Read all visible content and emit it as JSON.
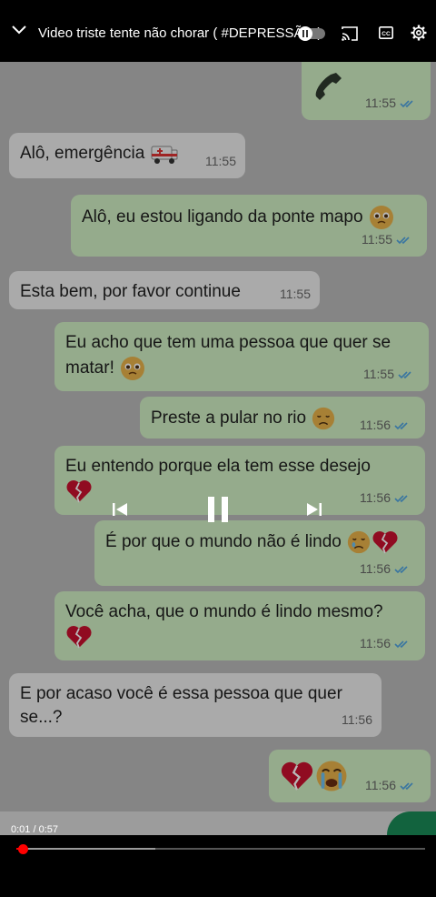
{
  "player": {
    "title": "Video triste tente não chorar ( #DEPRESSÃO )",
    "time_current": "0:01",
    "time_total": "0:57",
    "time_display": "0:01 / 0:57",
    "progress_fraction": 0.0175,
    "buffered_fraction": 0.34,
    "accent": "#ff0000"
  },
  "chat": {
    "messages": [
      {
        "dir": "out",
        "text": "",
        "time": "11:55",
        "emoji": "phone-icon"
      },
      {
        "dir": "in",
        "text": "Alô, emergência",
        "time": "11:55",
        "emoji": "ambulance-emoji"
      },
      {
        "dir": "out",
        "text": "Alô, eu estou ligando da ponte mapo",
        "time": "11:55",
        "emoji": "pleading-face-emoji"
      },
      {
        "dir": "in",
        "text": "Esta bem, por favor continue",
        "time": "11:55"
      },
      {
        "dir": "out",
        "text": "Eu acho que tem uma pessoa que quer se matar!",
        "time": "11:55",
        "emoji": "pleading-face-emoji"
      },
      {
        "dir": "out",
        "text": "Preste a pular no rio",
        "time": "11:56",
        "emoji": "disappointed-face-emoji"
      },
      {
        "dir": "out",
        "text": "Eu entendo porque ela tem esse desejo",
        "time": "11:56",
        "emoji": "broken-heart-emoji"
      },
      {
        "dir": "out",
        "text": "É por que o mundo não é lindo",
        "time": "11:56",
        "emoji": "sad-face-broken-heart-emoji"
      },
      {
        "dir": "out",
        "text": "Você acha, que o mundo é lindo mesmo?",
        "time": "11:56",
        "emoji": "broken-heart-emoji"
      },
      {
        "dir": "in",
        "text": "E por acaso você é essa pessoa que quer se...?",
        "time": "11:56"
      },
      {
        "dir": "out",
        "text": "",
        "time": "11:56",
        "emoji": "broken-heart-crying-face-emoji"
      }
    ]
  },
  "colors": {
    "incoming_bubble": "#ececec",
    "outgoing_bubble": "#cfeec2",
    "read_ticks": "#4fa3e0"
  }
}
